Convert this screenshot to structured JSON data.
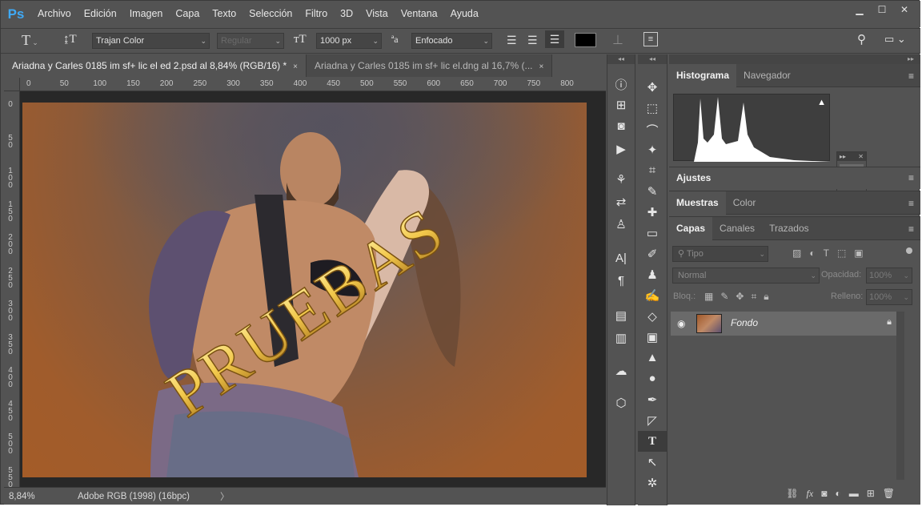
{
  "app": {
    "logo": "Ps"
  },
  "menu": [
    "Archivo",
    "Edición",
    "Imagen",
    "Capa",
    "Texto",
    "Selección",
    "Filtro",
    "3D",
    "Vista",
    "Ventana",
    "Ayuda"
  ],
  "window_buttons": {
    "minimize": "▁",
    "maximize": "☐",
    "close": "✕"
  },
  "options": {
    "font_family": "Trajan Color",
    "font_style": "Regular",
    "font_size": "1000 px",
    "antialias": "Enfocado",
    "color_hex": "#000000"
  },
  "tabs": [
    {
      "label": "Ariadna y Carles 0185 im sf+ lic el ed 2.psd al 8,84% (RGB/16) *",
      "close": "×"
    },
    {
      "label": "Ariadna y Carles 0185 im sf+ lic el.dng al 16,7% (...",
      "close": "×"
    }
  ],
  "ruler_top": [
    "0",
    "50",
    "100",
    "150",
    "200",
    "250",
    "300",
    "350",
    "400",
    "450",
    "500",
    "550",
    "600",
    "650",
    "700",
    "750",
    "800"
  ],
  "ruler_left": [
    "0",
    "5 0",
    "1 0 0",
    "1 5 0",
    "2 0 0",
    "2 5 0",
    "3 0 0",
    "3 5 0",
    "4 0 0",
    "4 5 0",
    "5 0 0",
    "5 5 0"
  ],
  "canvas": {
    "watermark": "PRUEBAS"
  },
  "status": {
    "zoom": "8,84%",
    "profile": "Adobe RGB (1998) (16bpc)",
    "arrow": "〉"
  },
  "panels": {
    "top_tabs": [
      "Histograma",
      "Navegador"
    ],
    "ajustes": "Ajustes",
    "muestras_tabs": [
      "Muestras",
      "Color"
    ],
    "layers_tabs": [
      "Capas",
      "Canales",
      "Trazados"
    ],
    "filter_placeholder": "Tipo",
    "blend_mode": "Normal",
    "opacity_label": "Opacidad:",
    "opacity_value": "100%",
    "lock_label": "Bloq.:",
    "fill_label": "Relleno:",
    "fill_value": "100%",
    "layer_name": "Fondo",
    "menu_icon": "≡"
  },
  "colors": {
    "bg": "#535353",
    "canvas": "#282828",
    "watermark": "#f2c84b",
    "accent": "#3fa9f5"
  }
}
